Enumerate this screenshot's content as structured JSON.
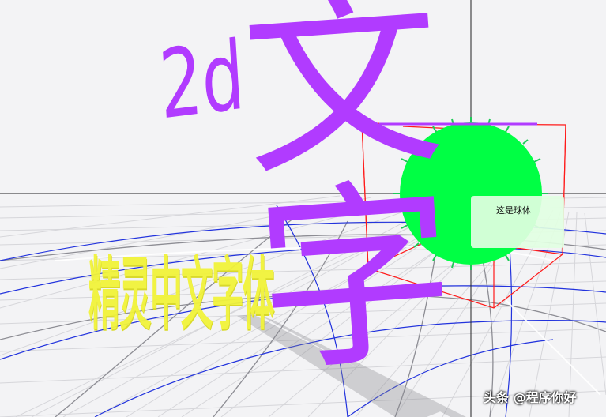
{
  "scene": {
    "text_2d_prefix": "2d",
    "text_2d_main": "文字",
    "sprite_text": "精灵中文字体",
    "sphere_tooltip": "这是球体",
    "watermark": "头条 @程序你好",
    "colors": {
      "background": "#f3f3f5",
      "grid_minor": "#d6d6da",
      "grid_major": "#9a9aa0",
      "curve_blue": "#2233dd",
      "text_2d": "#b13bff",
      "sprite_text": "#f1f33a",
      "sphere": "#00ff44",
      "bounding_box": "#ff1a1a",
      "crosshair": "#222222",
      "tooltip_bg": "#e2ffe2"
    }
  }
}
